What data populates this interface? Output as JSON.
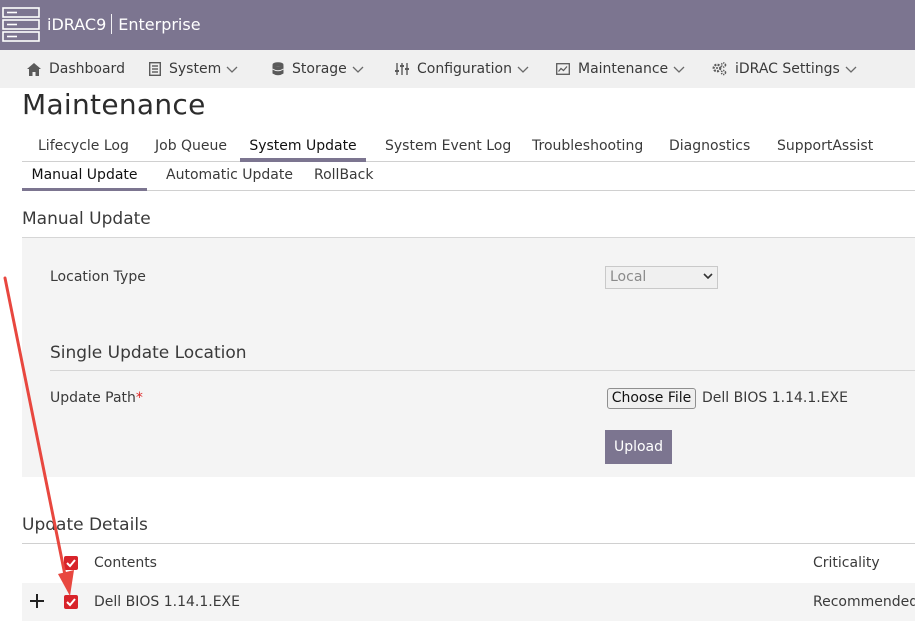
{
  "header": {
    "product": "iDRAC9",
    "edition": "Enterprise",
    "logo_icon": "server-rack-icon"
  },
  "nav": {
    "items": [
      {
        "label": "Dashboard",
        "icon": "home-icon"
      },
      {
        "label": "System",
        "icon": "server-icon"
      },
      {
        "label": "Storage",
        "icon": "database-icon"
      },
      {
        "label": "Configuration",
        "icon": "sliders-icon"
      },
      {
        "label": "Maintenance",
        "icon": "monitor-chart-icon"
      },
      {
        "label": "iDRAC Settings",
        "icon": "gears-icon"
      }
    ]
  },
  "page": {
    "title": "Maintenance"
  },
  "tabs": [
    "Lifecycle Log",
    "Job Queue",
    "System Update",
    "System Event Log",
    "Troubleshooting",
    "Diagnostics",
    "SupportAssist"
  ],
  "subtabs": [
    "Manual Update",
    "Automatic Update",
    "RollBack"
  ],
  "manual_update": {
    "title": "Manual Update",
    "location_type_label": "Location Type",
    "location_type_value": "Local",
    "single_update_title": "Single Update Location",
    "update_path_label": "Update Path",
    "required_mark": "*",
    "choose_file_label": "Choose File",
    "file_name": "Dell BIOS 1.14.1.EXE",
    "upload_label": "Upload"
  },
  "update_details": {
    "title": "Update Details",
    "columns": {
      "contents": "Contents",
      "criticality": "Criticality"
    },
    "rows": [
      {
        "contents": "Dell BIOS 1.14.1.EXE",
        "criticality": "Recommended",
        "checked": true
      }
    ]
  },
  "colors": {
    "header_bg": "#7c7590",
    "checkbox": "#d8232a",
    "annotation_arrow": "#e8473f"
  }
}
